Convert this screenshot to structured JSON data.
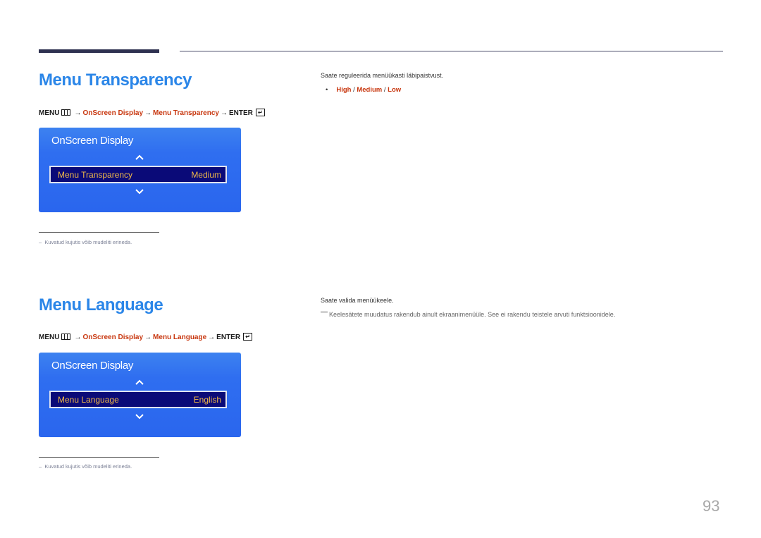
{
  "page_number": "93",
  "sections": [
    {
      "title": "Menu Transparency",
      "menu_path": {
        "menu": "MENU",
        "arrow": "→",
        "step1": "OnScreen Display",
        "step2": "Menu Transparency",
        "enter": "ENTER",
        "enter_glyph": "↵"
      },
      "osd": {
        "title": "OnScreen Display",
        "row_label": "Menu Transparency",
        "row_value": "Medium"
      },
      "note": "Kuvatud kujutis võib mudeliti erineda.",
      "note_dash": "–",
      "description": "Saate reguleerida menüükasti läbipaistvust.",
      "options": [
        "High",
        "Medium",
        "Low"
      ],
      "options_separator": "/",
      "bullet": "•"
    },
    {
      "title": "Menu Language",
      "menu_path": {
        "menu": "MENU",
        "arrow": "→",
        "step1": "OnScreen Display",
        "step2": "Menu Language",
        "enter": "ENTER",
        "enter_glyph": "↵"
      },
      "osd": {
        "title": "OnScreen Display",
        "row_label": "Menu Language",
        "row_value": "English"
      },
      "note": "Kuvatud kujutis võib mudeliti erineda.",
      "note_dash": "–",
      "description": "Saate valida menüükeele.",
      "dash_note": "Keelesätete muudatus rakendub ainult ekraanimenüüle. See ei rakendu teistele arvuti funktsioonidele."
    }
  ],
  "colors": {
    "title_blue": "#2b86e8",
    "path_red": "#c8370f",
    "osd_blue": "#2f6ef0",
    "osd_row_bg": "#0a0a78",
    "osd_text_gold": "#f0b848"
  }
}
